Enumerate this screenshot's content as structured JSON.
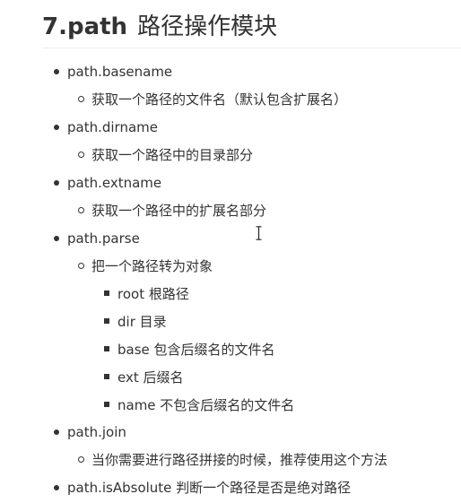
{
  "heading": {
    "prefix": "7.path",
    "title_zh": "路径操作模块"
  },
  "items": {
    "basename": {
      "label": "path.basename",
      "desc": "获取一个路径的文件名（默认包含扩展名）"
    },
    "dirname": {
      "label": "path.dirname",
      "desc": "获取一个路径中的目录部分"
    },
    "extname": {
      "label": "path.extname",
      "desc": "获取一个路径中的扩展名部分"
    },
    "parse": {
      "label": "path.parse",
      "desc": "把一个路径转为对象",
      "fields": [
        "root 根路径",
        "dir 目录",
        "base 包含后缀名的文件名",
        "ext 后缀名",
        "name 不包含后缀名的文件名"
      ]
    },
    "join": {
      "label": "path.join",
      "desc": "当你需要进行路径拼接的时候，推荐使用这个方法"
    },
    "isabsolute": {
      "label": "path.isAbsolute 判断一个路径是否是绝对路径"
    }
  }
}
